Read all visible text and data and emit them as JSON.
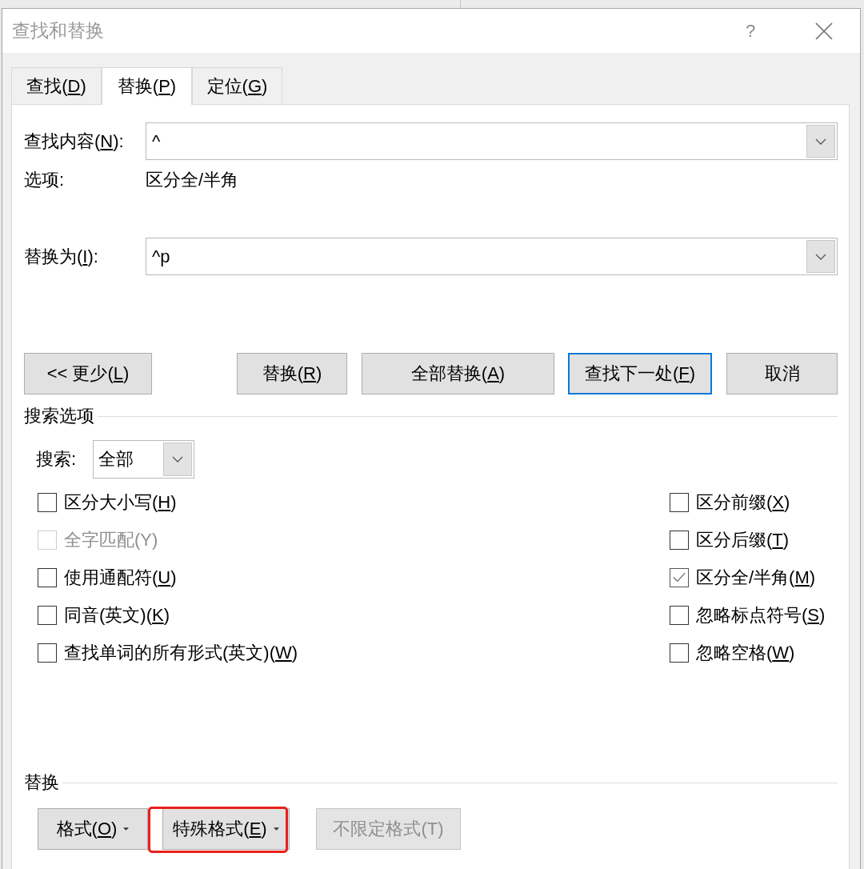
{
  "window": {
    "title": "查找和替换",
    "help": "?"
  },
  "tabs": [
    {
      "label": "查找(D)",
      "key_underlined": true,
      "selected": false
    },
    {
      "label": "替换(P)",
      "key_underlined": true,
      "selected": true
    },
    {
      "label": "定位(G)",
      "key_underlined": true,
      "selected": false
    }
  ],
  "find": {
    "label": "查找内容(N):",
    "key_underlined": true,
    "value": "^"
  },
  "options": {
    "label": "选项:",
    "value": "区分全/半角"
  },
  "replace_with": {
    "label": "替换为(I):",
    "key_underlined": true,
    "value": "^p"
  },
  "buttons": [
    {
      "label": "<< 更少(L)",
      "key_underlined": true,
      "focused": false
    },
    {
      "label": "替换(R)",
      "key_underlined": true,
      "focused": false
    },
    {
      "label": "全部替换(A)",
      "key_underlined": true,
      "focused": false
    },
    {
      "label": "查找下一处(F)",
      "key_underlined": true,
      "focused": true
    },
    {
      "label": "取消",
      "focused": false
    }
  ],
  "search_options": {
    "title": "搜索选项",
    "search_label": "搜索:",
    "search_value": "全部",
    "left": [
      {
        "label": "区分大小写(H)",
        "key_underlined": true,
        "checked": false,
        "disabled": false
      },
      {
        "label": "全字匹配(Y)",
        "key_underlined": false,
        "checked": false,
        "disabled": true
      },
      {
        "label": "使用通配符(U)",
        "key_underlined": true,
        "checked": false,
        "disabled": false
      },
      {
        "label": "同音(英文)(K)",
        "key_underlined": true,
        "checked": false,
        "disabled": false
      },
      {
        "label": "查找单词的所有形式(英文)(W)",
        "key_underlined": true,
        "checked": false,
        "disabled": false
      }
    ],
    "right": [
      {
        "label": "区分前缀(X)",
        "key_underlined": true,
        "checked": false,
        "disabled": false
      },
      {
        "label": "区分后缀(T)",
        "key_underlined": true,
        "checked": false,
        "disabled": false
      },
      {
        "label": "区分全/半角(M)",
        "key_underlined": true,
        "checked": true,
        "disabled": false
      },
      {
        "label": "忽略标点符号(S)",
        "key_underlined": true,
        "checked": false,
        "disabled": false
      },
      {
        "label": "忽略空格(W)",
        "key_underlined": true,
        "checked": false,
        "disabled": false
      }
    ]
  },
  "replace_section": {
    "title": "替换",
    "buttons": [
      {
        "label": "格式(O)",
        "key_underlined": true,
        "dropdown": true,
        "disabled": false,
        "highlighted": false
      },
      {
        "label": "特殊格式(E)",
        "key_underlined": true,
        "dropdown": true,
        "disabled": false,
        "highlighted": true
      },
      {
        "label": "不限定格式(T)",
        "key_underlined": false,
        "dropdown": false,
        "disabled": true,
        "highlighted": false
      }
    ]
  }
}
